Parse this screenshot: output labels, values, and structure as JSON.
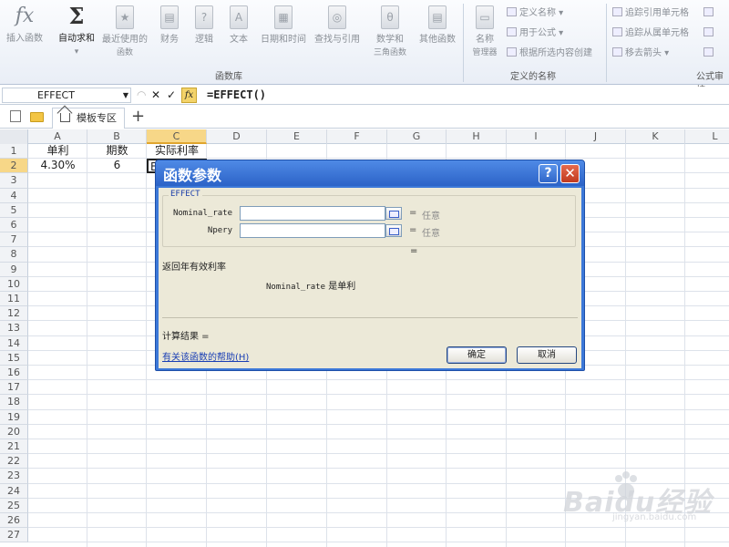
{
  "ribbon": {
    "insert_function": "插入函数",
    "autosum": "自动求和",
    "recent_line1": "最近使用的",
    "recent_line2": "函数",
    "financial": "财务",
    "logical": "逻辑",
    "text": "文本",
    "datetime": "日期和时间",
    "lookup": "查找与引用",
    "math_line1": "数学和",
    "math_line2": "三角函数",
    "more": "其他函数",
    "function_library": "函数库",
    "name_manager_line1": "名称",
    "name_manager_line2": "管理器",
    "define_name": "定义名称",
    "use_in_formula": "用于公式",
    "create_from_selection": "根据所选内容创建",
    "defined_names": "定义的名称",
    "trace_precedents": "追踪引用单元格",
    "trace_dependents": "追踪从属单元格",
    "remove_arrows": "移去箭头",
    "formula_auditing": "公式审核"
  },
  "formula_bar": {
    "name_box": "EFFECT",
    "cancel_icon": "✕",
    "enter_icon": "✓",
    "fx_label": "fx",
    "formula": "=EFFECT()"
  },
  "tabs": {
    "template_tab": "模板专区",
    "add": "+"
  },
  "grid": {
    "columns": [
      "A",
      "B",
      "C",
      "D",
      "E",
      "F",
      "G",
      "H",
      "I",
      "J",
      "K",
      "L"
    ],
    "rows": [
      "1",
      "2",
      "3",
      "4",
      "5",
      "6",
      "7",
      "8",
      "9",
      "10",
      "11",
      "12",
      "13",
      "14",
      "15",
      "16",
      "17",
      "18",
      "19",
      "20",
      "21",
      "22",
      "23",
      "24",
      "25",
      "26",
      "27"
    ],
    "a1": "单利",
    "b1": "期数",
    "c1": "实际利率",
    "a2": "4.30%",
    "b2": "6",
    "c2": "E"
  },
  "dialog": {
    "title": "函数参数",
    "help": "?",
    "close": "✕",
    "function_name": "EFFECT",
    "args": [
      {
        "label": "Nominal_rate",
        "eq": "=",
        "value": "任意"
      },
      {
        "label": "Npery",
        "eq": "=",
        "value": "任意"
      }
    ],
    "eq_summary": "=",
    "description": "返回年有效利率",
    "param_name": "Nominal_rate",
    "param_desc": "是单利",
    "result_label": "计算结果 =",
    "help_link": "有关该函数的帮助(H)",
    "ok": "确定",
    "cancel": "取消"
  },
  "watermark": {
    "text": "Baidu经验",
    "sub": "jingyan.baidu.com"
  }
}
